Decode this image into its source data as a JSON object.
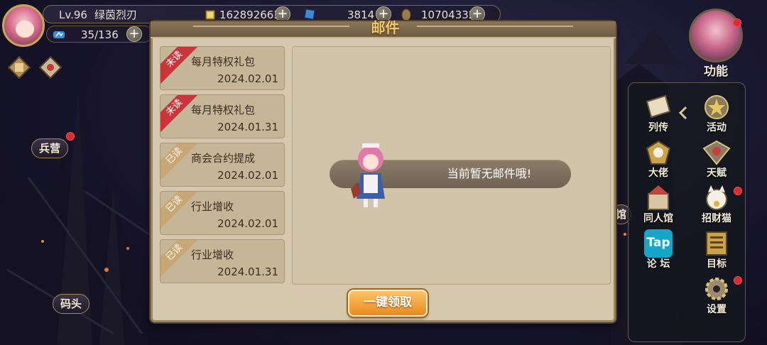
{
  "player": {
    "level": "Lv.96",
    "name": "绿茵烈刃",
    "stamina": "35/136"
  },
  "currencies": [
    {
      "icon": "gold-coin-icon",
      "value": "162892663"
    },
    {
      "icon": "blue-card-icon",
      "value": "3814"
    },
    {
      "icon": "bronze-coin-icon",
      "value": "10704332"
    }
  ],
  "side_labels": {
    "barracks": "兵营",
    "dock": "码头"
  },
  "function_button": {
    "label": "功能"
  },
  "right_panel": [
    {
      "label": "列传",
      "icon": "book-icon"
    },
    {
      "label": "活动",
      "icon": "star-medal-icon"
    },
    {
      "label": "大佬",
      "icon": "boss-crest-icon"
    },
    {
      "label": "天赋",
      "icon": "winged-crest-icon"
    },
    {
      "label": "同人馆",
      "icon": "castle-icon"
    },
    {
      "label": "招财猫",
      "icon": "lucky-cat-icon"
    },
    {
      "label": "论 坛",
      "icon": "tap-forum-icon",
      "badge": "Tap"
    },
    {
      "label": "目标",
      "icon": "target-scroll-icon"
    },
    {
      "label": "设置",
      "icon": "gear-icon"
    }
  ],
  "dialog": {
    "title": "邮件",
    "empty_message": "当前暂无邮件哦!",
    "claim_all_label": "一键领取"
  },
  "mails": [
    {
      "status": "未读",
      "subject": "每月特权礼包",
      "date": "2024.02.01",
      "read": false
    },
    {
      "status": "未读",
      "subject": "每月特权礼包",
      "date": "2024.01.31",
      "read": false
    },
    {
      "status": "已读",
      "subject": "商会合约提成",
      "date": "2024.02.01",
      "read": true
    },
    {
      "status": "已读",
      "subject": "行业增收",
      "date": "2024.02.01",
      "read": true
    },
    {
      "status": "已读",
      "subject": "行业增收",
      "date": "2024.01.31",
      "read": true
    }
  ],
  "partial_label": "馆",
  "colors": {
    "title_gold": "#f6c96a",
    "unread_red": "#c8353a",
    "read_tan": "#c9a676",
    "claim_orange": "#e98a1c"
  }
}
